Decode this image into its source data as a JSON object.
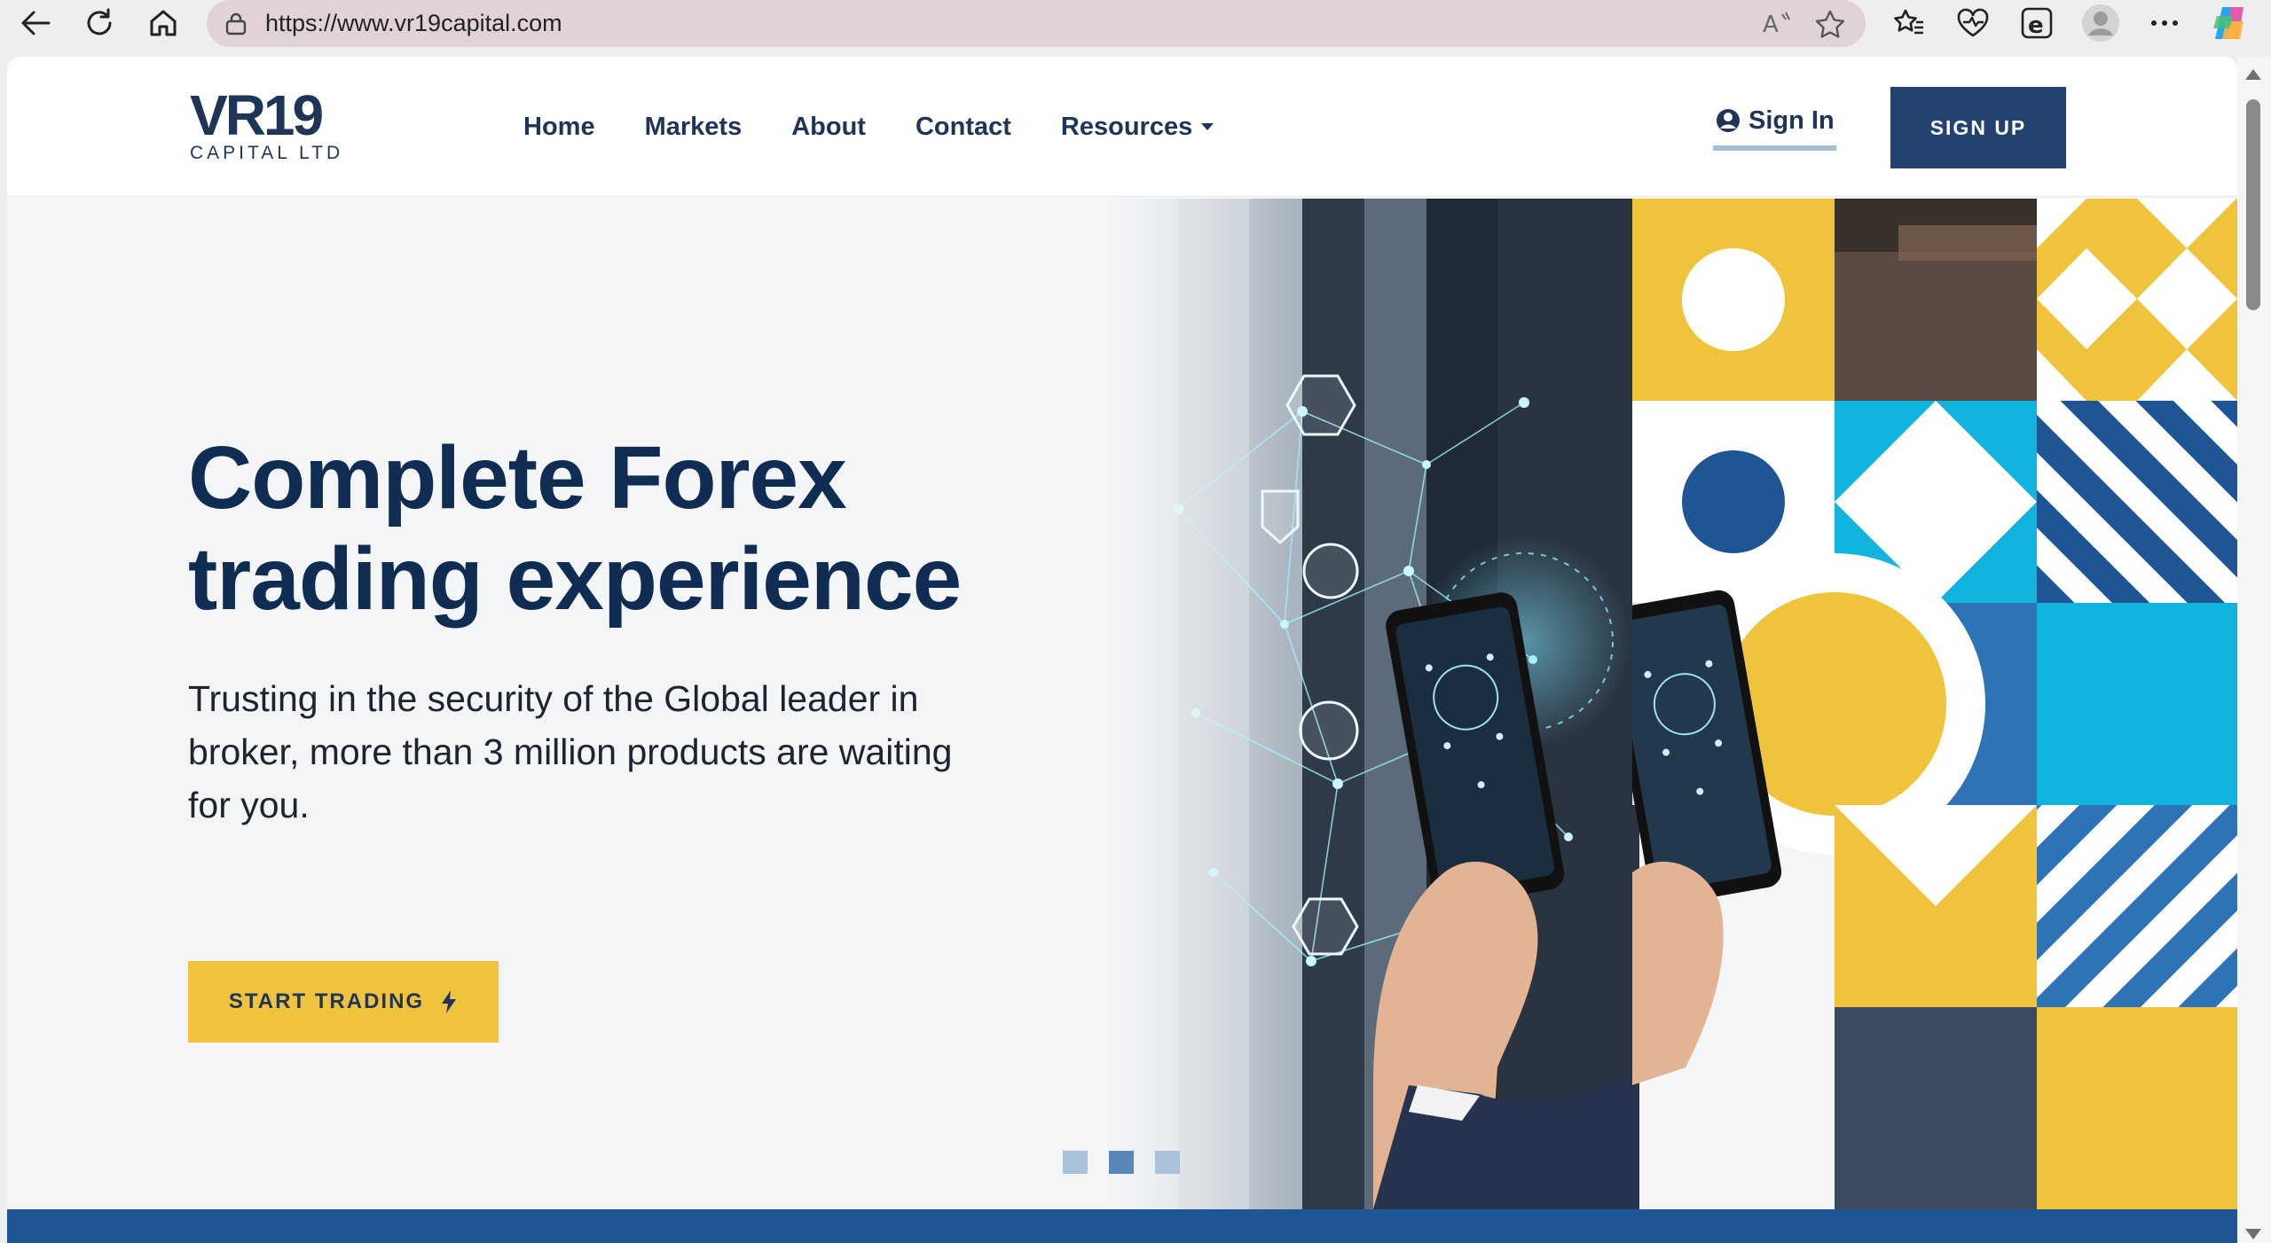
{
  "browser": {
    "url": "https://www.vr19capital.com"
  },
  "site": {
    "logo": {
      "main": "VR19",
      "sub": "CAPITAL LTD"
    },
    "nav": {
      "home": "Home",
      "markets": "Markets",
      "about": "About",
      "contact": "Contact",
      "resources": "Resources"
    },
    "sign_in": "Sign In",
    "sign_up": "SIGN UP"
  },
  "hero": {
    "title_line1": "Complete Forex",
    "title_line2": "trading experience",
    "lead_line1": "Trusting in the security of the Global leader in",
    "lead_line2": "broker, more than 3 million products are waiting",
    "lead_line3": "for you.",
    "cta": "START TRADING",
    "slides": 3,
    "active_slide": 2
  },
  "colors": {
    "navy": "#1e3558",
    "navy_dark": "#0f2d52",
    "signup_bg": "#234270",
    "yellow": "#f0c33c",
    "cyan": "#12b3dc",
    "blue": "#1f5594",
    "mid_blue": "#2f73b7"
  },
  "icons": [
    "back-arrow-icon",
    "refresh-icon",
    "home-icon",
    "lock-icon",
    "read-aloud-icon",
    "star-icon",
    "favorites-icon",
    "health-icon",
    "ie-mode-icon",
    "profile-icon",
    "more-icon",
    "copilot-icon",
    "user-circle-icon",
    "lightning-icon"
  ]
}
